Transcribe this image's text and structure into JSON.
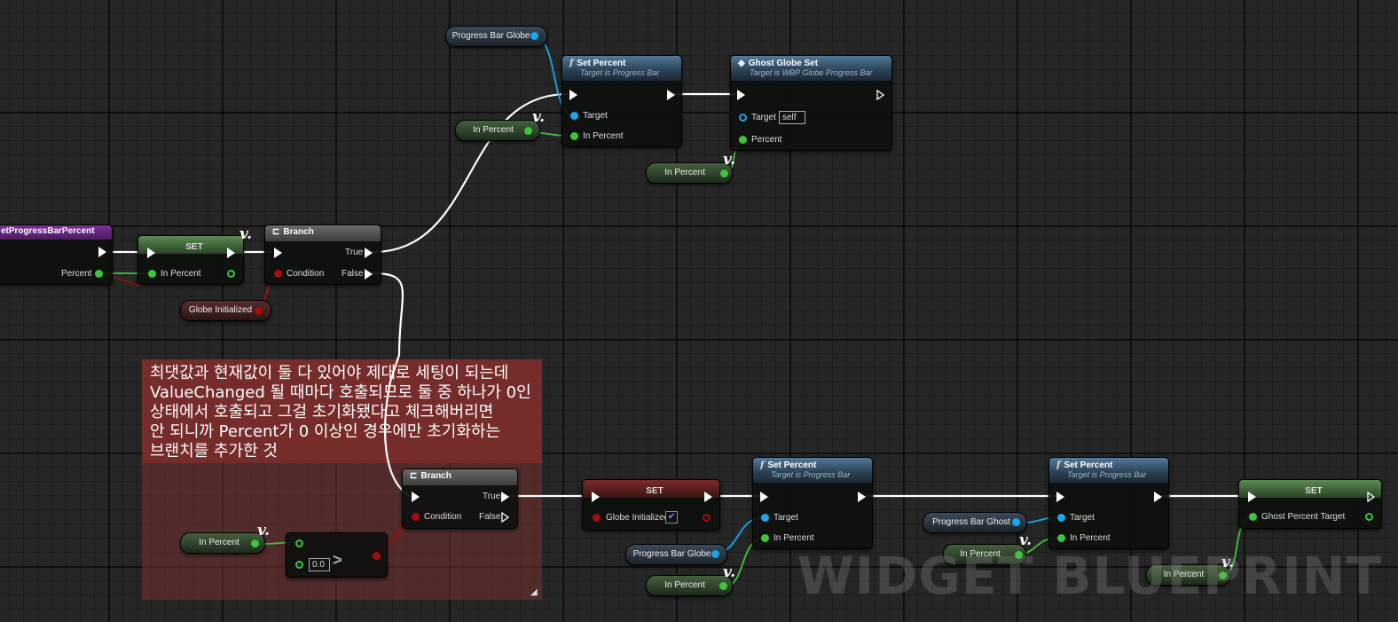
{
  "comment": {
    "lines": [
      "최댓값과 현재값이 둘 다 있어야 제대로 세팅이 되는데",
      "ValueChanged 될 때마다 호출되므로 둘 중 하나가 0인",
      "상태에서 호출되고 그걸 초기화됐다고 체크해버리면",
      "안 되니까 Percent가 0 이상인 경우에만 초기화하는",
      "브랜치를 추가한 것"
    ]
  },
  "nodes": {
    "event": {
      "title": "etProgressBarPercent",
      "pin_percent": "Percent"
    },
    "set1": {
      "title": "SET",
      "pin_in_percent": "In Percent"
    },
    "branch1": {
      "title": "Branch",
      "pin_condition": "Condition",
      "pin_true": "True",
      "pin_false": "False"
    },
    "set_percent1": {
      "title": "Set Percent",
      "subtitle": "Target is Progress Bar",
      "pin_target": "Target",
      "pin_in_percent": "In Percent"
    },
    "ghost_globe_set": {
      "title": "Ghost Globe Set",
      "subtitle": "Target is WBP Globe Progress Bar",
      "pin_target": "Target",
      "target_value": "self",
      "pin_percent": "Percent"
    },
    "branch2": {
      "title": "Branch",
      "pin_condition": "Condition",
      "pin_true": "True",
      "pin_false": "False"
    },
    "compare": {
      "op": ">",
      "value": "0.0"
    },
    "set2": {
      "title": "SET",
      "pin_globe_initialized": "Globe Initialized"
    },
    "set_percent2": {
      "title": "Set Percent",
      "subtitle": "Target is Progress Bar",
      "pin_target": "Target",
      "pin_in_percent": "In Percent"
    },
    "set_percent3": {
      "title": "Set Percent",
      "subtitle": "Target is Progress Bar",
      "pin_target": "Target",
      "pin_in_percent": "In Percent"
    },
    "set3": {
      "title": "SET",
      "pin_ghost_percent_target": "Ghost Percent Target"
    }
  },
  "variables": {
    "progress_bar_globe_top": "Progress Bar Globe",
    "in_percent_a": "In Percent",
    "in_percent_b": "In Percent",
    "globe_initialized": "Globe Initialized",
    "in_percent_c": "In Percent",
    "progress_bar_globe_bottom": "Progress Bar Globe",
    "in_percent_d": "In Percent",
    "progress_bar_ghost": "Progress Bar Ghost",
    "in_percent_e": "In Percent",
    "in_percent_f": "In Percent"
  },
  "watermark": "WIDGET BLUEPRINT",
  "colors": {
    "exec": "#ffffff",
    "float": "#3ec43e",
    "object": "#1aa6e8",
    "bool": "#a50d0d",
    "comment": "#772c2c"
  }
}
